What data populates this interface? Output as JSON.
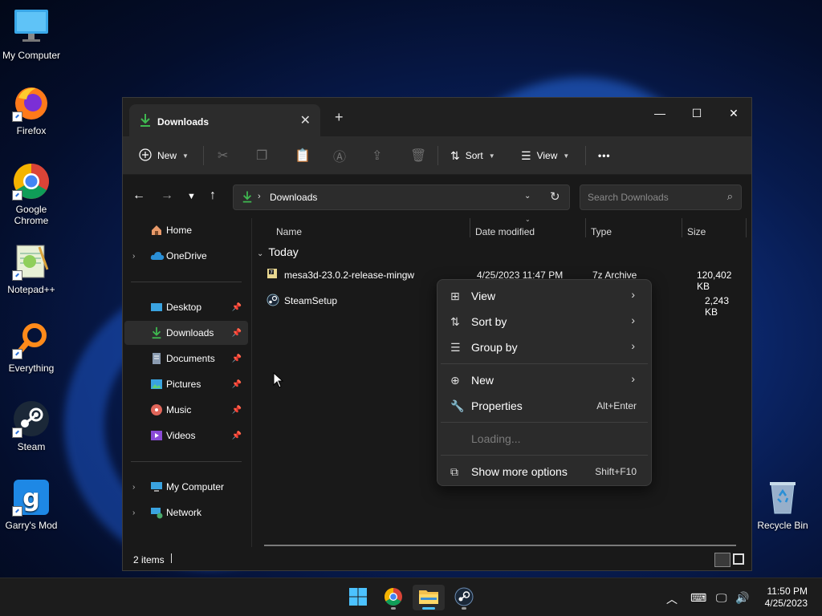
{
  "desktop": {
    "icons": [
      {
        "label": "My Computer"
      },
      {
        "label": "Firefox"
      },
      {
        "label": "Google Chrome"
      },
      {
        "label": "Notepad++"
      },
      {
        "label": "Everything"
      },
      {
        "label": "Steam"
      },
      {
        "label": "Garry's Mod"
      },
      {
        "label": "Recycle Bin"
      }
    ]
  },
  "window": {
    "tab_title": "Downloads",
    "toolbar": {
      "new_label": "New",
      "sort_label": "Sort",
      "view_label": "View",
      "more_label": "•••"
    },
    "address": {
      "path": "Downloads",
      "search_placeholder": "Search Downloads"
    },
    "sidebar": {
      "items": [
        {
          "label": "Home"
        },
        {
          "label": "OneDrive"
        },
        {
          "label": "Desktop"
        },
        {
          "label": "Downloads"
        },
        {
          "label": "Documents"
        },
        {
          "label": "Pictures"
        },
        {
          "label": "Music"
        },
        {
          "label": "Videos"
        },
        {
          "label": "My Computer"
        },
        {
          "label": "Network"
        }
      ]
    },
    "columns": [
      "Name",
      "Date modified",
      "Type",
      "Size"
    ],
    "group_label": "Today",
    "files": [
      {
        "name": "mesa3d-23.0.2-release-mingw",
        "date": "4/25/2023 11:47 PM",
        "type": "7z Archive",
        "size": "120,402 KB"
      },
      {
        "name": "SteamSetup",
        "date": "",
        "type": "",
        "size": "2,243 KB"
      }
    ],
    "status": "2 items"
  },
  "context_menu": {
    "items": [
      {
        "label": "View"
      },
      {
        "label": "Sort by"
      },
      {
        "label": "Group by"
      },
      {
        "label": "New"
      },
      {
        "label": "Properties",
        "shortcut": "Alt+Enter"
      },
      {
        "label": "Loading..."
      },
      {
        "label": "Show more options",
        "shortcut": "Shift+F10"
      }
    ]
  },
  "taskbar": {
    "time": "11:50 PM",
    "date": "4/25/2023"
  },
  "colors": {
    "accent": "#4cc2ff",
    "download_green": "#3fb950",
    "window_bg": "#191919",
    "menu_bg": "#2b2b2b"
  }
}
